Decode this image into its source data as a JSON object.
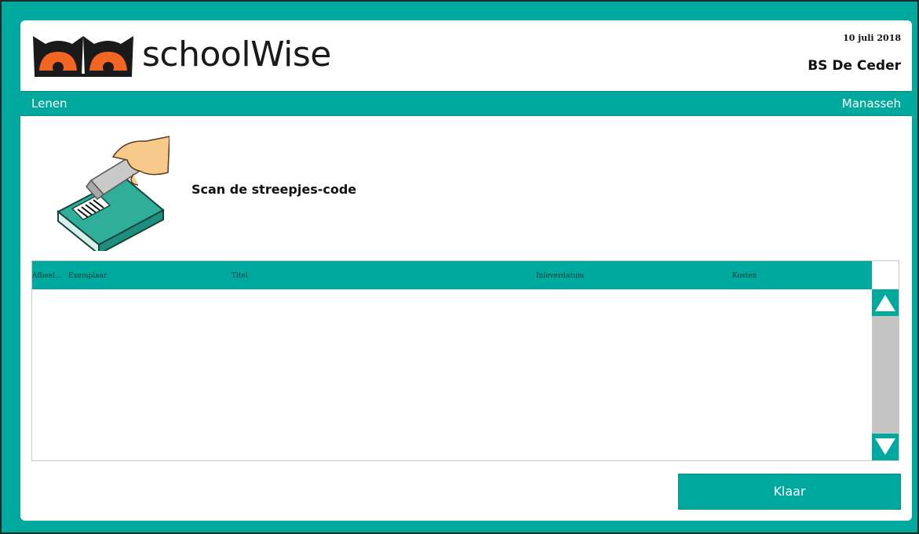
{
  "header": {
    "brand_name": "schoolWise",
    "date": "10 juli 2018",
    "school_name": "BS De Ceder"
  },
  "navbar": {
    "section": "Lenen",
    "user": "Manasseh"
  },
  "scan": {
    "instruction": "Scan de streepjes-code",
    "illustration_icon": "barcode-scanner-book-icon"
  },
  "table": {
    "columns": [
      "Afbeel...",
      "Exemplaar",
      "Titel",
      "Inleverdatum",
      "Kosten"
    ],
    "rows": []
  },
  "actions": {
    "done_label": "Klaar"
  },
  "colors": {
    "accent": "#00a99d",
    "logo_orange": "#f26522",
    "scrollbar_track": "#c4c4c4"
  }
}
